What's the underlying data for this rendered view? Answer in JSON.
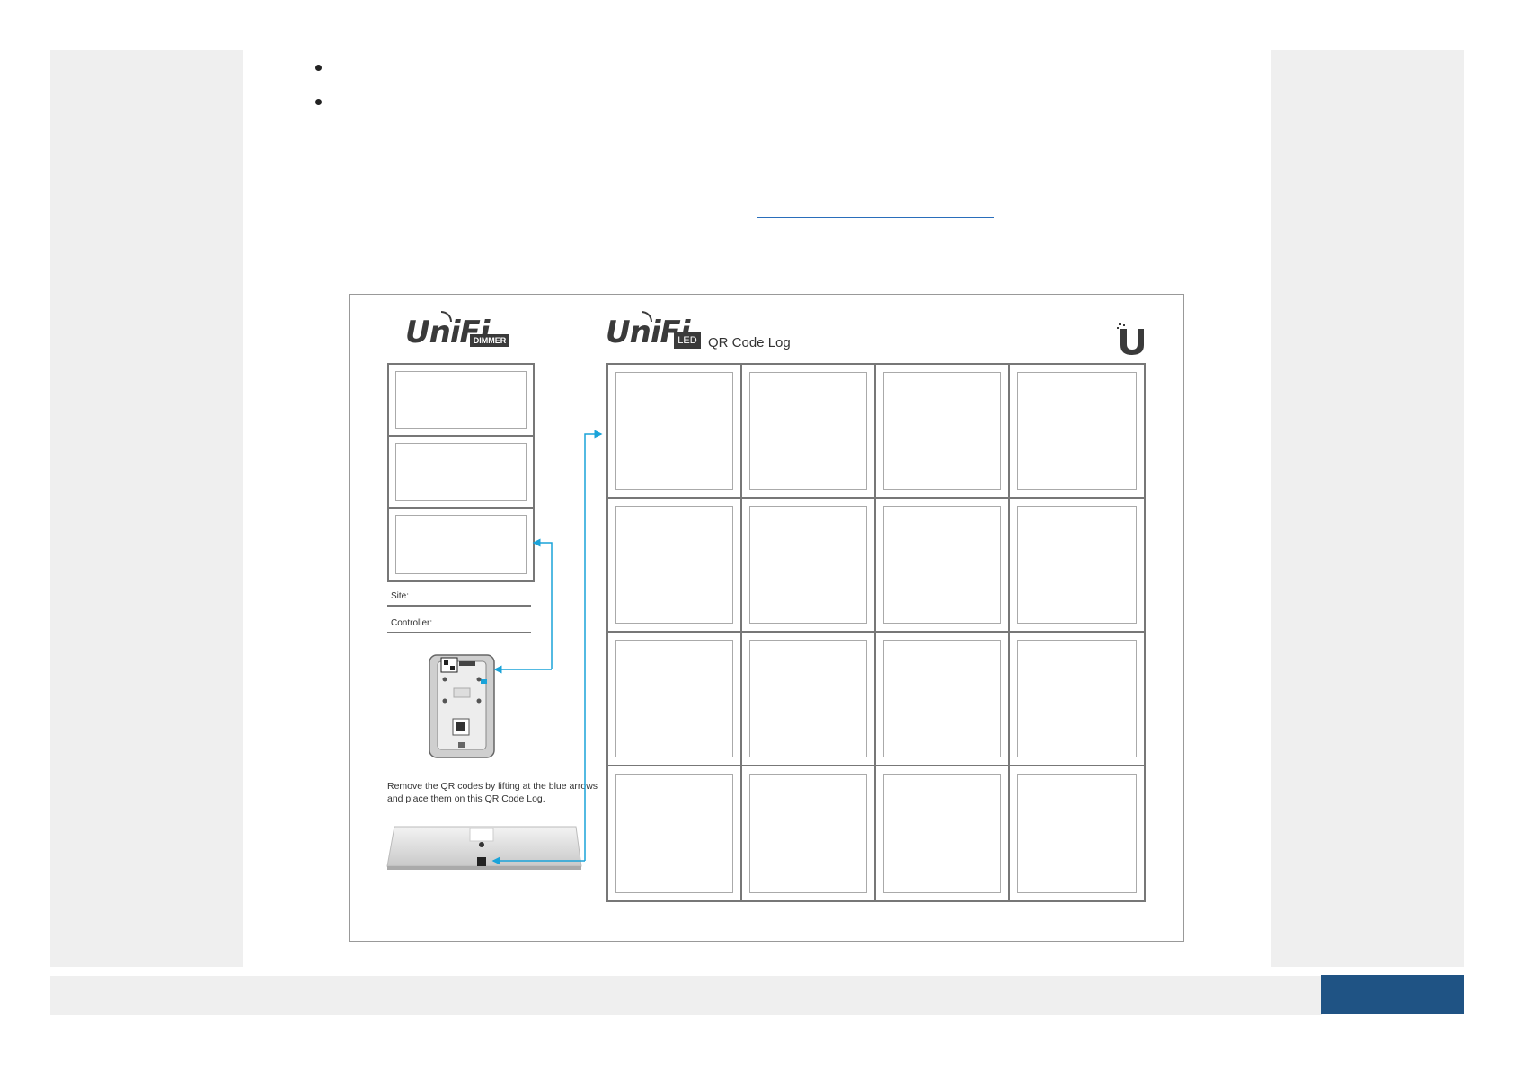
{
  "colors": {
    "panel": "#efefef",
    "accent": "#1f5384",
    "arrow": "#1aa3d9"
  },
  "figure": {
    "dimmer_brand": "UniFi",
    "dimmer_badge": "DIMMER",
    "led_brand": "UniFi",
    "led_badge": "LED",
    "log_title": "QR Code Log",
    "logo_icon": "ubiquiti-u-logo-icon",
    "fields": [
      {
        "label": "Site:"
      },
      {
        "label": "Controller:"
      }
    ],
    "instructions": "Remove the QR codes by lifting at the blue arrows and place them on this QR Code Log.",
    "dimmer_slots": 3,
    "grid": {
      "rows": 4,
      "cols": 4
    }
  }
}
